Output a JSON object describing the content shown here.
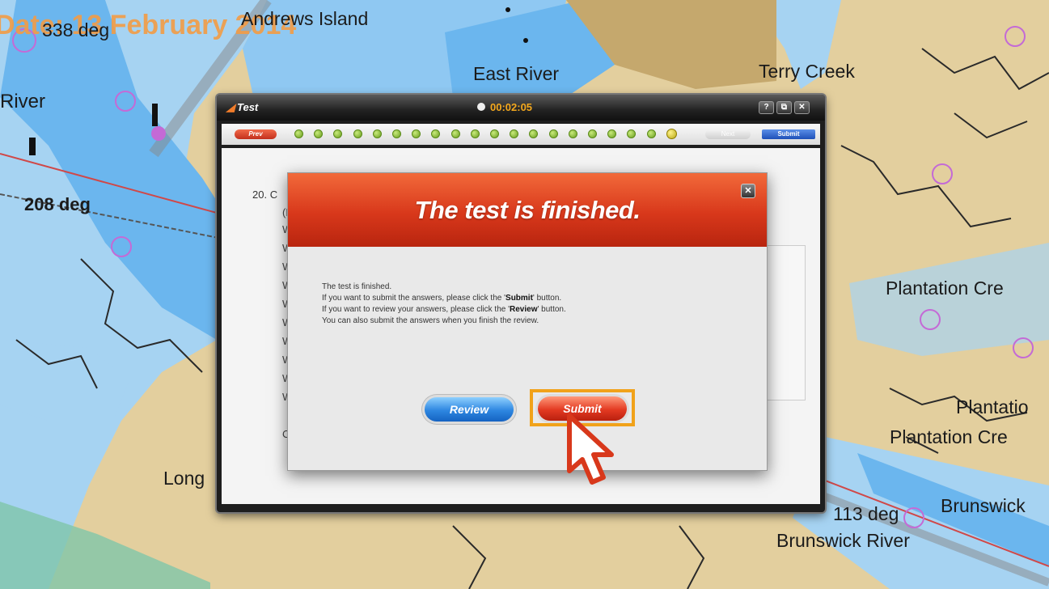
{
  "background_map": {
    "date_banner": "Date: 13 February 2014",
    "labels": [
      {
        "id": "map-label-338",
        "text": "338 deg"
      },
      {
        "id": "map-label-andrews",
        "text": "Andrews Island"
      },
      {
        "id": "map-label-east-river",
        "text": "East River"
      },
      {
        "id": "map-label-terry-creek",
        "text": "Terry Creek"
      },
      {
        "id": "map-label-river",
        "text": "River"
      },
      {
        "id": "map-label-208",
        "text": "208 deg"
      },
      {
        "id": "map-label-plantation1",
        "text": "Plantation Cre"
      },
      {
        "id": "map-label-plantation2",
        "text": "Plantatio"
      },
      {
        "id": "map-label-plantation3",
        "text": "Plantation Cre"
      },
      {
        "id": "map-label-113",
        "text": "113 deg"
      },
      {
        "id": "map-label-brunswick",
        "text": "Brunswick"
      },
      {
        "id": "map-label-brunswick-river",
        "text": "Brunswick River"
      },
      {
        "id": "map-label-long",
        "text": "Long"
      }
    ]
  },
  "test_window": {
    "title": "Test",
    "timer": "00:02:05",
    "window_buttons": [
      "?",
      "⧉",
      "✕"
    ],
    "prev_label": "Prev",
    "next_label": "Next",
    "submit_label": "Submit",
    "question_count": 20,
    "current_question": 20,
    "question_number": "20.",
    "question_start": "C",
    "question_paren": "(F",
    "option_letter": "W",
    "bottom_letter": "C",
    "long_label": "Long"
  },
  "modal": {
    "title": "The test is finished.",
    "close_label": "✕",
    "body": {
      "line1": "The test is finished.",
      "line2_pre": "If you want to submit the answers, please click the '",
      "line2_bold": "Submit",
      "line2_post": "' button.",
      "line3_pre": "If you want to review your answers, please click the '",
      "line3_bold": "Review",
      "line3_post": "' button.",
      "line4": "You can also submit the answers when you finish the review."
    },
    "review_label": "Review",
    "submit_label": "Submit"
  },
  "colors": {
    "accent_orange": "#f1a21a",
    "header_red": "#d8381b",
    "review_blue": "#2d86e0",
    "timer_gold": "#f4a81d"
  }
}
